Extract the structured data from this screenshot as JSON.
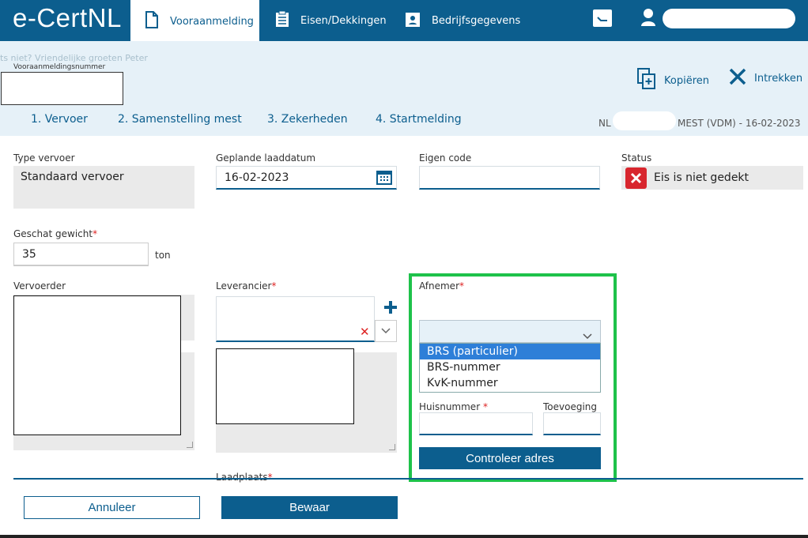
{
  "app": {
    "brand": "e-CertNL"
  },
  "nav": {
    "tabs": [
      {
        "label": "Vooraanmelding",
        "icon": "document-icon",
        "active": true
      },
      {
        "label": "Eisen/Dekkingen",
        "icon": "clipboard-icon"
      },
      {
        "label": "Bedrijfsgegevens",
        "icon": "id-card-icon"
      }
    ],
    "message_icon": "message-icon",
    "user_icon": "user-icon"
  },
  "header": {
    "ghost_text": "ts niet?  Vriendelijke groeten  Peter",
    "vooraanmelding_label": "Vooraanmeldingsnummer",
    "actions": {
      "copy": "Kopiëren",
      "withdraw": "Intrekken"
    },
    "steps": [
      "1. Vervoer",
      "2. Samenstelling mest",
      "3. Zekerheden",
      "4. Startmelding"
    ],
    "meta_prefix": "NL",
    "meta_suffix": "MEST (VDM) - 16-02-2023"
  },
  "form": {
    "type_vervoer": {
      "label": "Type vervoer",
      "value": "Standaard vervoer"
    },
    "laaddatum": {
      "label": "Geplande laaddatum",
      "value": "16-02-2023"
    },
    "eigen_code": {
      "label": "Eigen code"
    },
    "status": {
      "label": "Status",
      "value": "Eis is niet gedekt"
    },
    "gewicht": {
      "label": "Geschat gewicht",
      "value": "35",
      "unit": "ton"
    },
    "vervoerder": {
      "label": "Vervoerder"
    },
    "leverancier": {
      "label": "Leverancier"
    },
    "afnemer": {
      "label": "Afnemer",
      "options": [
        "BRS (particulier)",
        "BRS-nummer",
        "KvK-nummer"
      ],
      "selected": "BRS (particulier)"
    },
    "huisnummer": {
      "label": "Huisnummer"
    },
    "toevoeging": {
      "label": "Toevoeging"
    },
    "controleer": "Controleer adres",
    "laadplaats": {
      "label": "Laadplaats"
    }
  },
  "footer": {
    "cancel": "Annuleer",
    "save": "Bewaar"
  },
  "colors": {
    "primary": "#0c5e8e",
    "highlight": "#1ec24a",
    "error": "#d8262e",
    "selected": "#2e7fd8"
  }
}
